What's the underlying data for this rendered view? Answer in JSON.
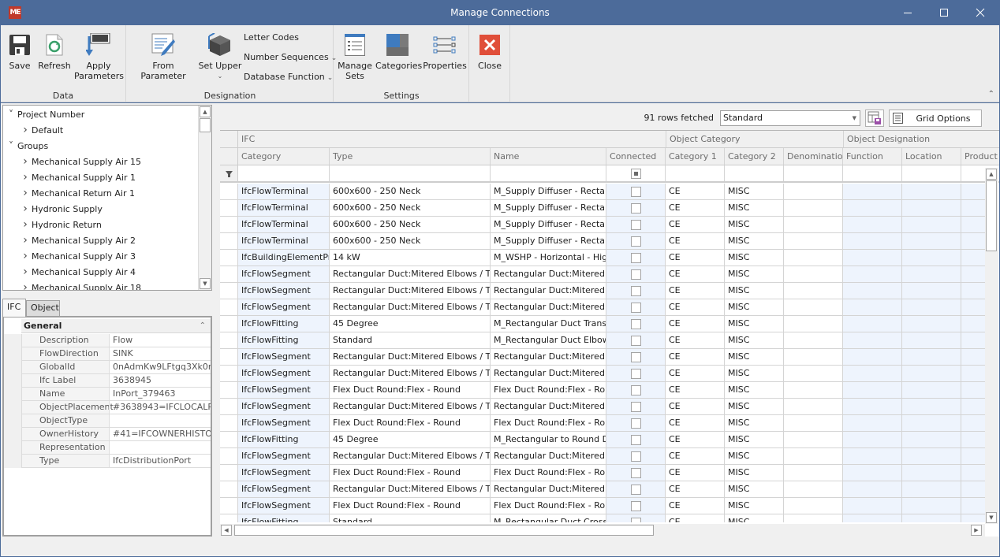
{
  "window": {
    "title": "Manage Connections",
    "app_icon": "app-logo-icon",
    "controls": [
      "minimize",
      "maximize",
      "close"
    ]
  },
  "ribbon": {
    "groups": [
      {
        "label": "Data",
        "buttons": [
          {
            "label": "Save",
            "icon": "floppy-disk-icon"
          },
          {
            "label": "Refresh",
            "icon": "refresh-document-icon"
          },
          {
            "label": "Apply Parameters",
            "icon": "apply-parameters-icon"
          }
        ]
      },
      {
        "label": "Designation",
        "buttons": [
          {
            "label": "From Parameter",
            "icon": "edit-list-icon"
          },
          {
            "label": "Set Upper",
            "icon": "cube-icon",
            "has_dropdown": true
          }
        ],
        "small_buttons": [
          {
            "label": "Letter Codes"
          },
          {
            "label": "Number Sequences",
            "has_dropdown": true
          },
          {
            "label": "Database Function",
            "has_dropdown": true
          }
        ]
      },
      {
        "label": "Settings",
        "buttons": [
          {
            "label": "Manage Sets",
            "icon": "list-window-icon"
          },
          {
            "label": "Categories",
            "icon": "categories-icon"
          },
          {
            "label": "Properties",
            "icon": "properties-arrows-icon"
          }
        ]
      },
      {
        "label": "",
        "buttons": [
          {
            "label": "Close",
            "icon": "close-red-icon"
          }
        ]
      }
    ],
    "labels": {
      "save": "Save",
      "refresh": "Refresh",
      "apply1": "Apply",
      "apply2": "Parameters",
      "from_parameter": "From Parameter",
      "set_upper": "Set Upper",
      "letter_codes": "Letter Codes",
      "number_sequences": "Number Sequences",
      "database_function": "Database Function",
      "manage1": "Manage",
      "manage2": "Sets",
      "categories": "Categories",
      "properties": "Properties",
      "close": "Close",
      "group_data": "Data",
      "group_designation": "Designation",
      "group_settings": "Settings"
    }
  },
  "tree": {
    "items": [
      {
        "label": "Project Number",
        "level": 0,
        "expanded": true
      },
      {
        "label": "Default",
        "level": 1,
        "expanded": false
      },
      {
        "label": "Groups",
        "level": 0,
        "expanded": true
      },
      {
        "label": "Mechanical Supply Air 15",
        "level": 1,
        "expanded": false
      },
      {
        "label": "Mechanical Supply Air 1",
        "level": 1,
        "expanded": false
      },
      {
        "label": "Mechanical Return Air 1",
        "level": 1,
        "expanded": false
      },
      {
        "label": "Hydronic Supply",
        "level": 1,
        "expanded": false
      },
      {
        "label": "Hydronic Return",
        "level": 1,
        "expanded": false
      },
      {
        "label": "Mechanical Supply Air 2",
        "level": 1,
        "expanded": false
      },
      {
        "label": "Mechanical Supply Air 3",
        "level": 1,
        "expanded": false
      },
      {
        "label": "Mechanical Supply Air 4",
        "level": 1,
        "expanded": false
      },
      {
        "label": "Mechanical Supply Air 18",
        "level": 1,
        "expanded": false
      }
    ]
  },
  "property_tabs": [
    {
      "label": "IFC",
      "active": true
    },
    {
      "label": "Object",
      "active": false
    }
  ],
  "properties": {
    "section": "General",
    "rows": [
      {
        "name": "Description",
        "value": "Flow"
      },
      {
        "name": "FlowDirection",
        "value": "SINK"
      },
      {
        "name": "GlobalId",
        "value": "0nAdmKw9LFtgq3Xk0m..."
      },
      {
        "name": "Ifc Label",
        "value": "3638945"
      },
      {
        "name": "Name",
        "value": "InPort_379463"
      },
      {
        "name": "ObjectPlacement",
        "value": "#3638943=IFCLOCALP..."
      },
      {
        "name": "ObjectType",
        "value": ""
      },
      {
        "name": "OwnerHistory",
        "value": "#41=IFCOWNERHISTO..."
      },
      {
        "name": "Representation",
        "value": ""
      },
      {
        "name": "Type",
        "value": "IfcDistributionPort"
      }
    ]
  },
  "grid_toolbar": {
    "rows_fetched": "91 rows fetched",
    "layout_value": "Standard",
    "grid_options_label": "Grid Options"
  },
  "grid": {
    "bands": [
      {
        "label": "IFC"
      },
      {
        "label": "Object Category"
      },
      {
        "label": "Object Designation"
      }
    ],
    "columns": [
      "Category",
      "Type",
      "Name",
      "Connected",
      "Category 1",
      "Category 2",
      "Denomination",
      "Function",
      "Location",
      "Product"
    ],
    "rows": [
      [
        "IfcFlowTerminal",
        "600x600 - 250 Neck",
        "M_Supply Diffuser - Recta...",
        false,
        "CE",
        "MISC",
        "",
        "",
        "",
        ""
      ],
      [
        "IfcFlowTerminal",
        "600x600 - 250 Neck",
        "M_Supply Diffuser - Recta...",
        false,
        "CE",
        "MISC",
        "",
        "",
        "",
        ""
      ],
      [
        "IfcFlowTerminal",
        "600x600 - 250 Neck",
        "M_Supply Diffuser - Recta...",
        false,
        "CE",
        "MISC",
        "",
        "",
        "",
        ""
      ],
      [
        "IfcFlowTerminal",
        "600x600 - 250 Neck",
        "M_Supply Diffuser - Recta...",
        false,
        "CE",
        "MISC",
        "",
        "",
        "",
        ""
      ],
      [
        "IfcBuildingElementPr...",
        "14 kW",
        "M_WSHP - Horizontal - Hig...",
        false,
        "CE",
        "MISC",
        "",
        "",
        "",
        ""
      ],
      [
        "IfcFlowSegment",
        "Rectangular Duct:Mitered Elbows / Tees",
        "Rectangular Duct:Mitered ...",
        false,
        "CE",
        "MISC",
        "",
        "",
        "",
        ""
      ],
      [
        "IfcFlowSegment",
        "Rectangular Duct:Mitered Elbows / Tees",
        "Rectangular Duct:Mitered ...",
        false,
        "CE",
        "MISC",
        "",
        "",
        "",
        ""
      ],
      [
        "IfcFlowSegment",
        "Rectangular Duct:Mitered Elbows / Tees",
        "Rectangular Duct:Mitered ...",
        false,
        "CE",
        "MISC",
        "",
        "",
        "",
        ""
      ],
      [
        "IfcFlowFitting",
        "45 Degree",
        "M_Rectangular Duct Transi...",
        false,
        "CE",
        "MISC",
        "",
        "",
        "",
        ""
      ],
      [
        "IfcFlowFitting",
        "Standard",
        "M_Rectangular Duct Elbow...",
        false,
        "CE",
        "MISC",
        "",
        "",
        "",
        ""
      ],
      [
        "IfcFlowSegment",
        "Rectangular Duct:Mitered Elbows / Tees",
        "Rectangular Duct:Mitered ...",
        false,
        "CE",
        "MISC",
        "",
        "",
        "",
        ""
      ],
      [
        "IfcFlowSegment",
        "Rectangular Duct:Mitered Elbows / Taps",
        "Rectangular Duct:Mitered ...",
        false,
        "CE",
        "MISC",
        "",
        "",
        "",
        ""
      ],
      [
        "IfcFlowSegment",
        "Flex Duct Round:Flex - Round",
        "Flex Duct Round:Flex - Ro...",
        false,
        "CE",
        "MISC",
        "",
        "",
        "",
        ""
      ],
      [
        "IfcFlowSegment",
        "Rectangular Duct:Mitered Elbows / Taps",
        "Rectangular Duct:Mitered ...",
        false,
        "CE",
        "MISC",
        "",
        "",
        "",
        ""
      ],
      [
        "IfcFlowSegment",
        "Flex Duct Round:Flex - Round",
        "Flex Duct Round:Flex - Ro...",
        false,
        "CE",
        "MISC",
        "",
        "",
        "",
        ""
      ],
      [
        "IfcFlowFitting",
        "45 Degree",
        "M_Rectangular to Round D...",
        false,
        "CE",
        "MISC",
        "",
        "",
        "",
        ""
      ],
      [
        "IfcFlowSegment",
        "Rectangular Duct:Mitered Elbows / Taps",
        "Rectangular Duct:Mitered ...",
        false,
        "CE",
        "MISC",
        "",
        "",
        "",
        ""
      ],
      [
        "IfcFlowSegment",
        "Flex Duct Round:Flex - Round",
        "Flex Duct Round:Flex - Ro...",
        false,
        "CE",
        "MISC",
        "",
        "",
        "",
        ""
      ],
      [
        "IfcFlowSegment",
        "Rectangular Duct:Mitered Elbows / Taps",
        "Rectangular Duct:Mitered ...",
        false,
        "CE",
        "MISC",
        "",
        "",
        "",
        ""
      ],
      [
        "IfcFlowSegment",
        "Flex Duct Round:Flex - Round",
        "Flex Duct Round:Flex - Ro...",
        false,
        "CE",
        "MISC",
        "",
        "",
        "",
        ""
      ],
      [
        "IfcFlowFitting",
        "Standard",
        "M_Rectangular Duct Cross...",
        false,
        "CE",
        "MISC",
        "",
        "",
        "",
        ""
      ]
    ]
  },
  "colors": {
    "titlebar": "#4c6b9a",
    "readonly_cell": "#eef4fd",
    "close_icon": "#e04e39",
    "accent_blue": "#3f7bbf"
  }
}
